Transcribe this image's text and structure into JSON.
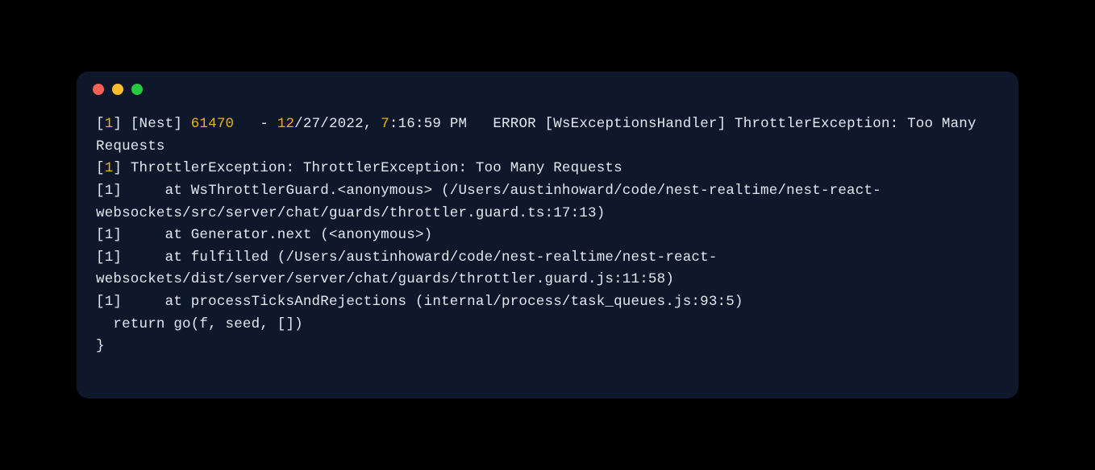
{
  "log": {
    "prefix_open": "[",
    "prefix_close": "]",
    "one": "1",
    "nest": "Nest",
    "pid": "61470",
    "dash": " - ",
    "month": "12",
    "slash": "/",
    "day": "27",
    "year": "2022",
    "comma_space": ", ",
    "hour": "7",
    "colon": ":",
    "min": "16",
    "sec": "59",
    "ampm": " PM",
    "error_label": "ERROR",
    "handler": "WsExceptionsHandler",
    "exception_name": "ThrottlerException",
    "exception_msg": "Too Many Requests",
    "trace_1": "[1]     at WsThrottlerGuard.<anonymous> (/Users/austinhoward/code/nest-realtime/nest-react-websockets/src/server/chat/guards/throttler.guard.ts:17:13)",
    "trace_2": "[1]     at Generator.next (<anonymous>)",
    "trace_3": "[1]     at fulfilled (/Users/austinhoward/code/nest-realtime/nest-react-websockets/dist/server/server/chat/guards/throttler.guard.js:11:58)",
    "trace_4": "[1]     at processTicksAndRejections (internal/process/task_queues.js:93:5)",
    "return_line": "  return go(f, seed, [])",
    "brace": "}"
  }
}
